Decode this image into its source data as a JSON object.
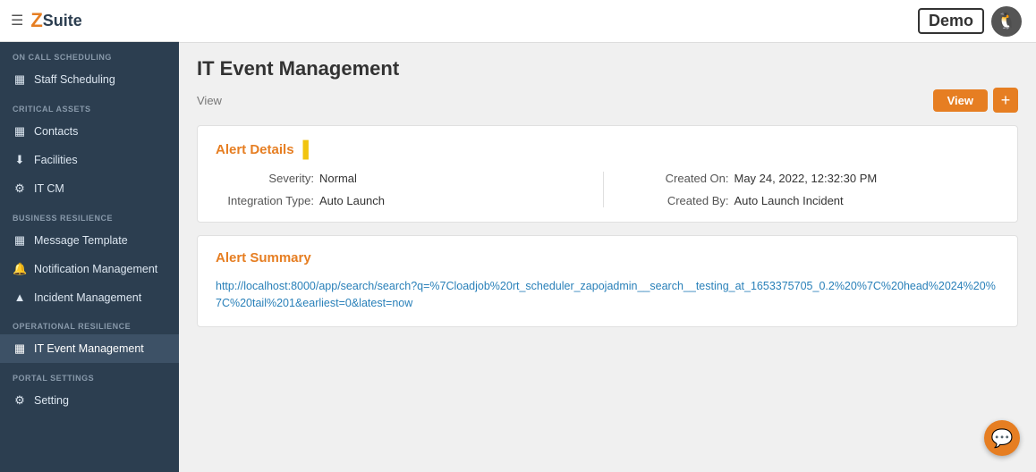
{
  "sidebar": {
    "logo": "Z Suite",
    "z": "Z",
    "suite": "Suite",
    "sections": [
      {
        "label": "ON CALL SCHEDULING",
        "items": [
          {
            "icon": "▦",
            "text": "Staff Scheduling",
            "active": false
          }
        ]
      },
      {
        "label": "CRITICAL ASSETS",
        "items": [
          {
            "icon": "▦",
            "text": "Contacts",
            "active": false
          },
          {
            "icon": "⬇",
            "text": "Facilities",
            "active": false
          },
          {
            "icon": "⚙",
            "text": "IT CM",
            "active": false
          }
        ]
      },
      {
        "label": "BUSINESS RESILIENCE",
        "items": [
          {
            "icon": "▦",
            "text": "Message Template",
            "active": false
          },
          {
            "icon": "🔔",
            "text": "Notification Management",
            "active": false
          },
          {
            "icon": "▲",
            "text": "Incident Management",
            "active": false
          }
        ]
      },
      {
        "label": "OPERATIONAL RESILIENCE",
        "items": [
          {
            "icon": "▦",
            "text": "IT Event Management",
            "active": true
          }
        ]
      },
      {
        "label": "PORTAL SETTINGS",
        "items": [
          {
            "icon": "⚙",
            "text": "Setting",
            "active": false
          }
        ]
      }
    ]
  },
  "topbar": {
    "demo_label": "Demo",
    "linux_icon": "🐧"
  },
  "page": {
    "title": "IT Event Management",
    "breadcrumb": "View",
    "view_button": "View",
    "plus_button": "+"
  },
  "alert_details": {
    "card_title": "Alert Details",
    "warning_symbol": "▌",
    "fields": {
      "severity_label": "Severity:",
      "severity_value": "Normal",
      "integration_type_label": "Integration Type:",
      "integration_type_value": "Auto Launch",
      "created_on_label": "Created On:",
      "created_on_value": "May 24, 2022, 12:32:30 PM",
      "created_by_label": "Created By:",
      "created_by_value": "Auto Launch Incident"
    }
  },
  "alert_summary": {
    "card_title": "Alert Summary",
    "url": "http://localhost:8000/app/search/search?q=%7Cloadjob%20rt_scheduler_zapojadmin__search__testing_at_1653375705_0.2%20%7C%20head%2024%20%7C%20tail%201&earliest=0&latest=now"
  },
  "chat_fab": {
    "icon": "💬"
  }
}
